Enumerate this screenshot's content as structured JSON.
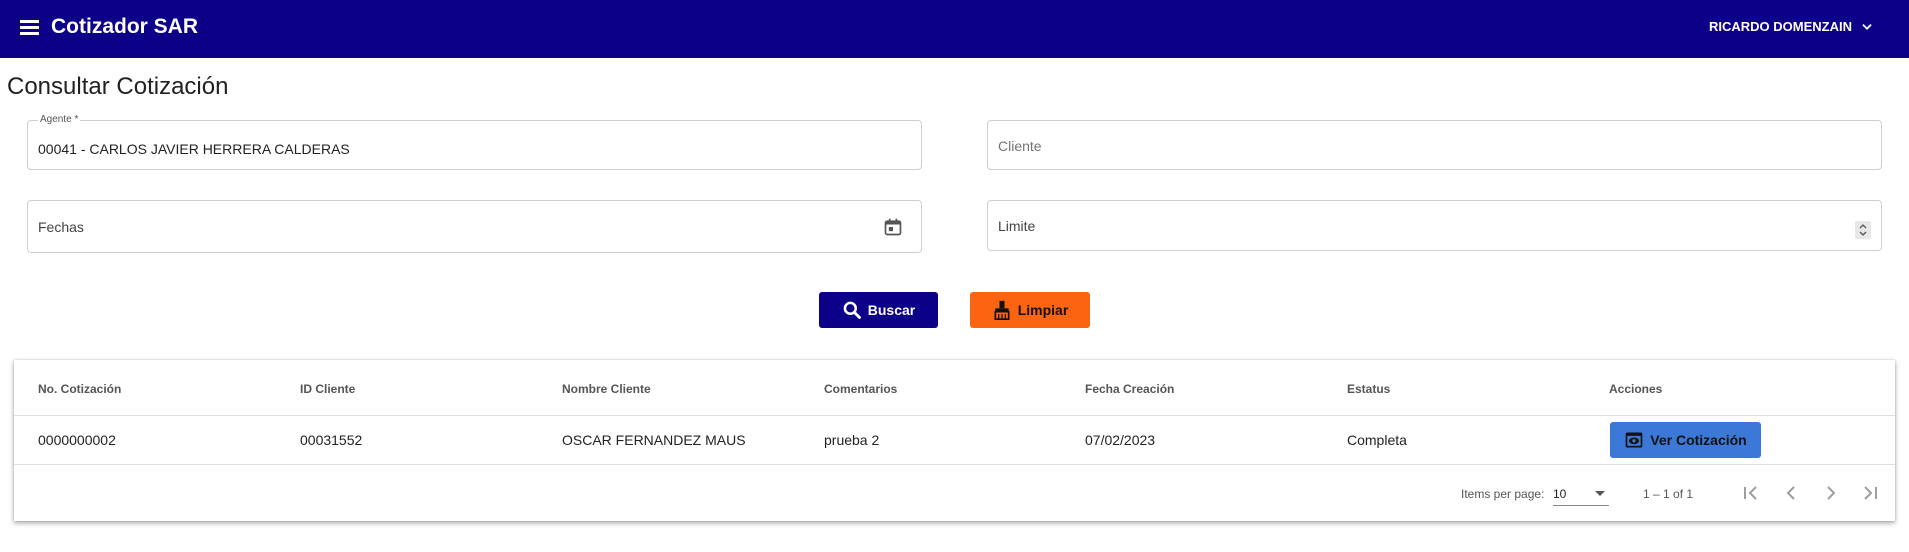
{
  "header": {
    "menu_icon": "menu-icon",
    "app_title": "Cotizador SAR",
    "user_name": "RICARDO DOMENZAIN",
    "user_chevron_icon": "chevron-down-icon",
    "background_color": "#0d0088"
  },
  "page": {
    "title": "Consultar Cotización"
  },
  "form": {
    "agente": {
      "label": "Agente *",
      "value": "00041 - CARLOS JAVIER HERRERA CALDERAS"
    },
    "cliente": {
      "placeholder": "Cliente",
      "value": ""
    },
    "fechas": {
      "placeholder": "Fechas",
      "icon": "calendar-icon"
    },
    "limite": {
      "placeholder": "Limite",
      "icon": "spinner-icon"
    }
  },
  "actions": {
    "buscar": {
      "label": "Buscar",
      "icon": "search-icon",
      "color": "#0d0088"
    },
    "limpiar": {
      "label": "Limpiar",
      "icon": "broom-icon",
      "color": "#fb6410"
    }
  },
  "table": {
    "columns": [
      "No. Cotización",
      "ID Cliente",
      "Nombre Cliente",
      "Comentarios",
      "Fecha Creación",
      "Estatus",
      "Acciones"
    ],
    "rows": [
      {
        "no_cotizacion": "0000000002",
        "id_cliente": "00031552",
        "nombre_cliente": "OSCAR FERNANDEZ MAUS",
        "comentarios": "prueba 2",
        "fecha_creacion": "07/02/2023",
        "estatus": "Completa",
        "action_label": "Ver Cotización",
        "action_icon": "eye-icon",
        "action_color": "#3c78d8"
      }
    ]
  },
  "paginator": {
    "items_per_page_label": "Items per page:",
    "items_per_page_value": "10",
    "range_label": "1 – 1 of 1",
    "icons": [
      "first-page-icon",
      "previous-page-icon",
      "next-page-icon",
      "last-page-icon"
    ]
  }
}
